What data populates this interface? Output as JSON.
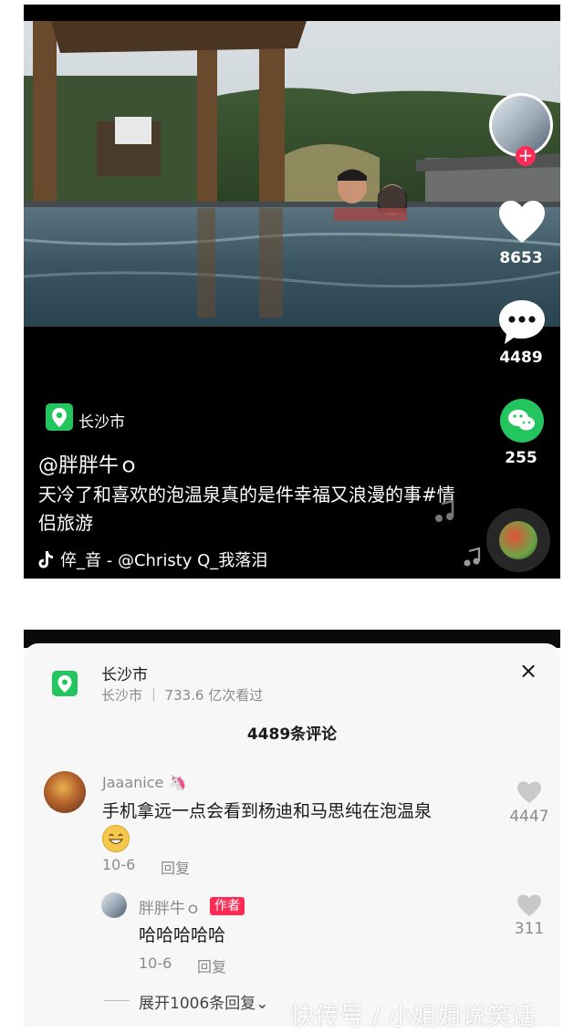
{
  "video": {
    "likes": "8653",
    "comments": "4489",
    "shares": "255",
    "location": "长沙市",
    "author": "@胖胖牛ｏ",
    "description": "天冷了和喜欢的泡温泉真的是件幸福又浪漫的事#情侣旅游",
    "music": "倅_音 - @Christy    Q_我落泪",
    "follow_symbol": "+",
    "icons": [
      "location-icon",
      "heart-icon",
      "comment-icon",
      "wechat-icon",
      "music-note-icon"
    ]
  },
  "comments_panel": {
    "city": "长沙市",
    "city_meta": "长沙市 ｜ 733.6 亿次看过",
    "close_symbol": "×",
    "count_title": "4489条评论",
    "comment": {
      "username": "Jaaanice 🦄",
      "text": "手机拿远一点会看到杨迪和马思纯在泡温泉",
      "date": "10-6",
      "reply_label": "回复",
      "likes": "4447"
    },
    "reply": {
      "username": "胖胖牛ｏ",
      "badge": "作者",
      "text": "哈哈哈哈哈",
      "date": "10-6",
      "reply_label": "回复",
      "likes": "311"
    },
    "expand_label": "展开1006条回复⌄"
  },
  "watermark": "快传号 / 小姐姐说笑话"
}
